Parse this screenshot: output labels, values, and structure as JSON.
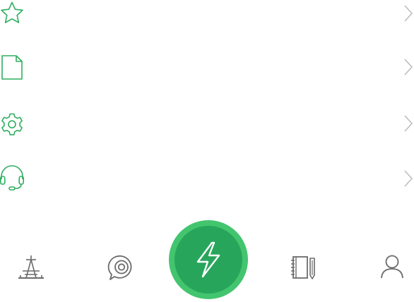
{
  "colors": {
    "accent": "#2fae5f",
    "fab_outer": "#43c56f",
    "fab_inner": "#27a65b",
    "chevron": "#b9b9b9",
    "tab_icon": "#6b6b6b"
  },
  "menu": {
    "items": [
      {
        "icon": "star-icon",
        "label": ""
      },
      {
        "icon": "document-icon",
        "label": ""
      },
      {
        "icon": "gear-icon",
        "label": ""
      },
      {
        "icon": "headset-icon",
        "label": ""
      }
    ]
  },
  "tabbar": {
    "tabs": [
      {
        "icon": "tower-icon"
      },
      {
        "icon": "chat-bubble-icon"
      },
      {
        "icon": "lightning-icon",
        "center": true
      },
      {
        "icon": "notebook-pencil-icon"
      },
      {
        "icon": "person-icon"
      }
    ]
  }
}
